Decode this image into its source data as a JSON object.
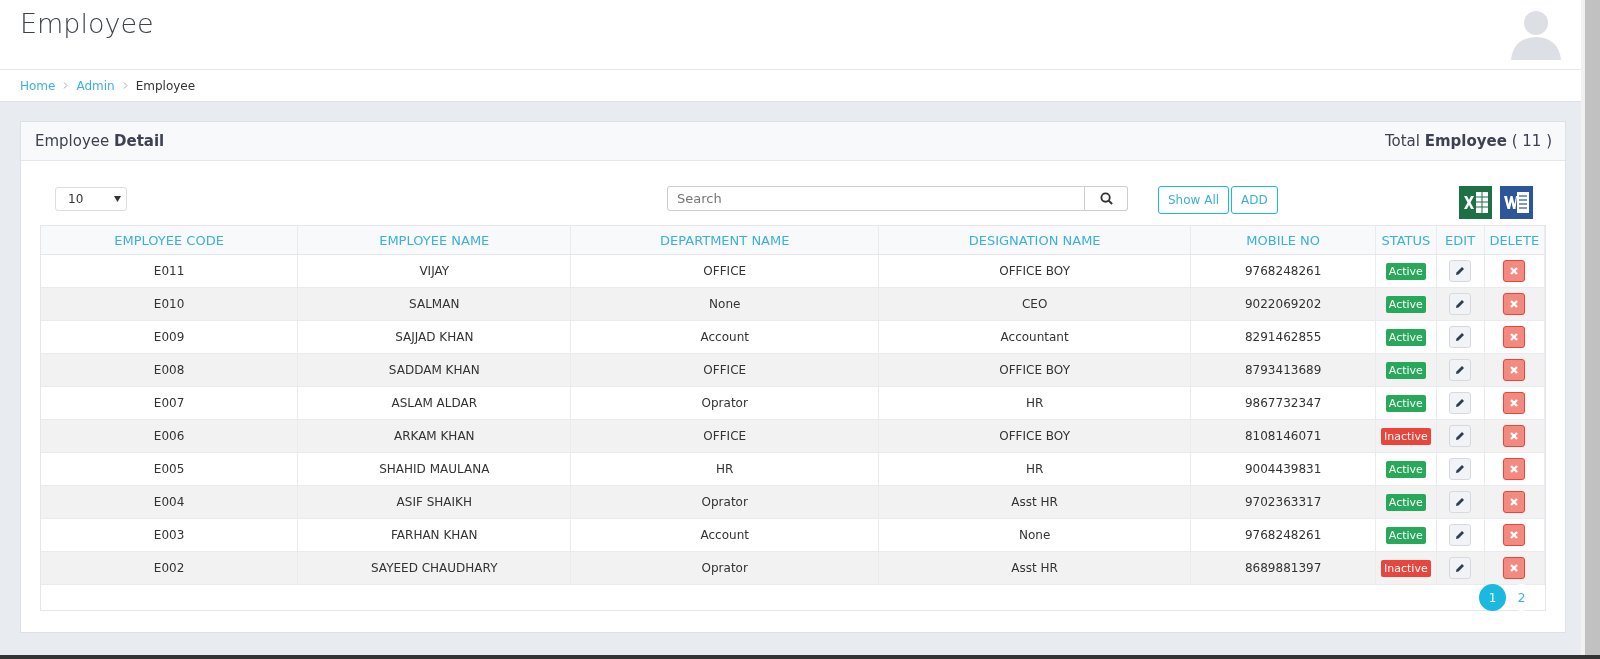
{
  "page_title": "Employee",
  "breadcrumb": [
    {
      "label": "Home",
      "link": true
    },
    {
      "label": "Admin",
      "link": true
    },
    {
      "label": "Employee",
      "link": false
    }
  ],
  "panel": {
    "title": "Employee",
    "title_bold": "Detail",
    "total_label": "Total",
    "total_bold": "Employee",
    "total_count": "( 11 )"
  },
  "page_size": "10",
  "search": {
    "placeholder": "Search"
  },
  "buttons": [
    "Show All",
    "ADD"
  ],
  "columns": [
    "EMPLOYEE CODE",
    "EMPLOYEE NAME",
    "DEPARTMENT NAME",
    "DESIGNATION NAME",
    "MOBILE NO",
    "STATUS",
    "EDIT",
    "DELETE"
  ],
  "rows": [
    {
      "code": "E011",
      "name": "VIJAY",
      "department": "OFFICE",
      "designation": "OFFICE BOY",
      "mobile": "9768248261",
      "status": "Active",
      "active": true
    },
    {
      "code": "E010",
      "name": "SALMAN",
      "department": "None",
      "designation": "CEO",
      "mobile": "9022069202",
      "status": "Active",
      "active": true
    },
    {
      "code": "E009",
      "name": "SAJJAD KHAN",
      "department": "Account",
      "designation": "Accountant",
      "mobile": "8291462855",
      "status": "Active",
      "active": true
    },
    {
      "code": "E008",
      "name": "SADDAM KHAN",
      "department": "OFFICE",
      "designation": "OFFICE BOY",
      "mobile": "8793413689",
      "status": "Active",
      "active": true
    },
    {
      "code": "E007",
      "name": "ASLAM ALDAR",
      "department": "Oprator",
      "designation": "HR",
      "mobile": "9867732347",
      "status": "Active",
      "active": true
    },
    {
      "code": "E006",
      "name": "ARKAM KHAN",
      "department": "OFFICE",
      "designation": "OFFICE BOY",
      "mobile": "8108146071",
      "status": "Inactive",
      "active": false
    },
    {
      "code": "E005",
      "name": "SHAHID MAULANA",
      "department": "HR",
      "designation": "HR",
      "mobile": "9004439831",
      "status": "Active",
      "active": true
    },
    {
      "code": "E004",
      "name": "ASIF SHAIKH",
      "department": "Oprator",
      "designation": "Asst HR",
      "mobile": "9702363317",
      "status": "Active",
      "active": true
    },
    {
      "code": "E003",
      "name": "FARHAN KHAN",
      "department": "Account",
      "designation": "None",
      "mobile": "9768248261",
      "status": "Active",
      "active": true
    },
    {
      "code": "E002",
      "name": "SAYEED CHAUDHARY",
      "department": "Oprator",
      "designation": "Asst HR",
      "mobile": "8689881397",
      "status": "Inactive",
      "active": false
    }
  ],
  "pagination": [
    {
      "label": "1",
      "selected": true
    },
    {
      "label": "2",
      "selected": false
    }
  ]
}
